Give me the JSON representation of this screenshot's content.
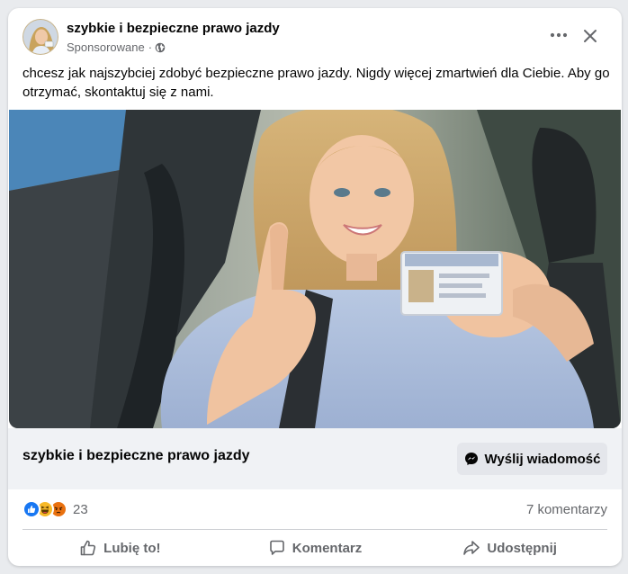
{
  "post": {
    "page_name": "szybkie i bezpieczne prawo jazdy",
    "sponsored_label": "Sponsorowane",
    "separator": "·",
    "audience_icon": "globe-icon",
    "text": "chcesz jak najszybciej zdobyć bezpieczne prawo jazdy. Nigdy więcej zmartwień dla Ciebie. Aby go otrzymać, skontaktuj się z nami.",
    "image_subject": "woman in car holding driving licence giving thumbs up"
  },
  "cta": {
    "title": "szybkie i bezpieczne prawo jazdy",
    "button_label": "Wyślij wiadomość",
    "button_icon": "messenger-icon"
  },
  "engagement": {
    "reactions": [
      "like",
      "haha",
      "angry"
    ],
    "reaction_count": "23",
    "comments": "7 komentarzy"
  },
  "actions": {
    "like": "Lubię to!",
    "comment": "Komentarz",
    "share": "Udostępnij"
  },
  "colors": {
    "card_bg": "#ffffff",
    "page_bg": "#e9ebee",
    "cta_bg": "#f0f2f5",
    "secondary_text": "#65676b",
    "like_blue": "#1877f2",
    "haha_yellow": "#f7b928",
    "angry_orange": "#e9710f"
  }
}
